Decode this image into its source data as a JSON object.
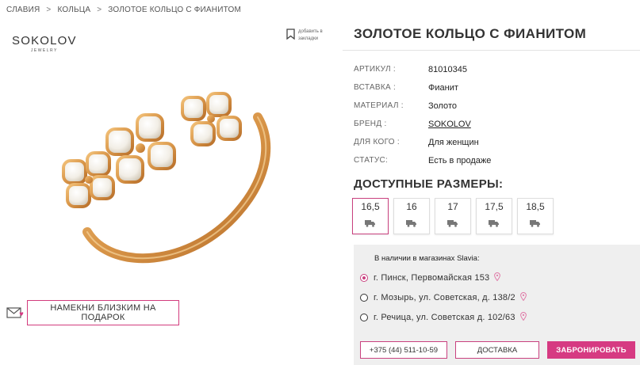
{
  "breadcrumb": {
    "items": [
      "СЛАВИЯ",
      "КОЛЬЦА",
      "ЗОЛОТОЕ КОЛЬЦО С ФИАНИТОМ"
    ],
    "separator": ">"
  },
  "brand_logo": {
    "name": "SOKOLOV",
    "tagline": "JEWELRY"
  },
  "favorites": {
    "label": "добавить в закладки",
    "icon": "bookmark-icon"
  },
  "gift_hint": {
    "label": "НАМЕКНИ БЛИЗКИМ НА ПОДАРОК",
    "icon": "envelope-heart-icon"
  },
  "product": {
    "title": "ЗОЛОТОЕ КОЛЬЦО С ФИАНИТОМ",
    "specs": [
      {
        "label": "АРТИКУЛ :",
        "value": "81010345"
      },
      {
        "label": "ВСТАВКА :",
        "value": "Фианит"
      },
      {
        "label": "МАТЕРИАЛ :",
        "value": "Золото"
      },
      {
        "label": "БРЕНД :",
        "value": "SOKOLOV"
      },
      {
        "label": "ДЛЯ КОГО :",
        "value": "Для женщин"
      },
      {
        "label": "СТАТУС:",
        "value": "Есть в продаже"
      }
    ]
  },
  "sizes": {
    "title": "ДОСТУПНЫЕ РАЗМЕРЫ:",
    "selected": "16,5",
    "items": [
      "16,5",
      "16",
      "17",
      "17,5",
      "18,5"
    ],
    "delivery_icon": "truck-icon"
  },
  "stores": {
    "title": "В наличии в магазинах Slavia:",
    "selected_index": 0,
    "items": [
      "г. Пинск, Первомайская 153",
      "г. Мозырь, ул. Советская, д. 138/2",
      "г. Речица, ул. Советская д. 102/63"
    ],
    "pin_icon": "map-pin-icon"
  },
  "actions": {
    "phone": "+375 (44) 511-10-59",
    "delivery": "ДОСТАВКА",
    "reserve": "ЗАБРОНИРОВАТЬ"
  },
  "colors": {
    "accent": "#d63a82",
    "gold": "#d89548",
    "stone": "#f2eee6",
    "panel": "#efefef"
  }
}
